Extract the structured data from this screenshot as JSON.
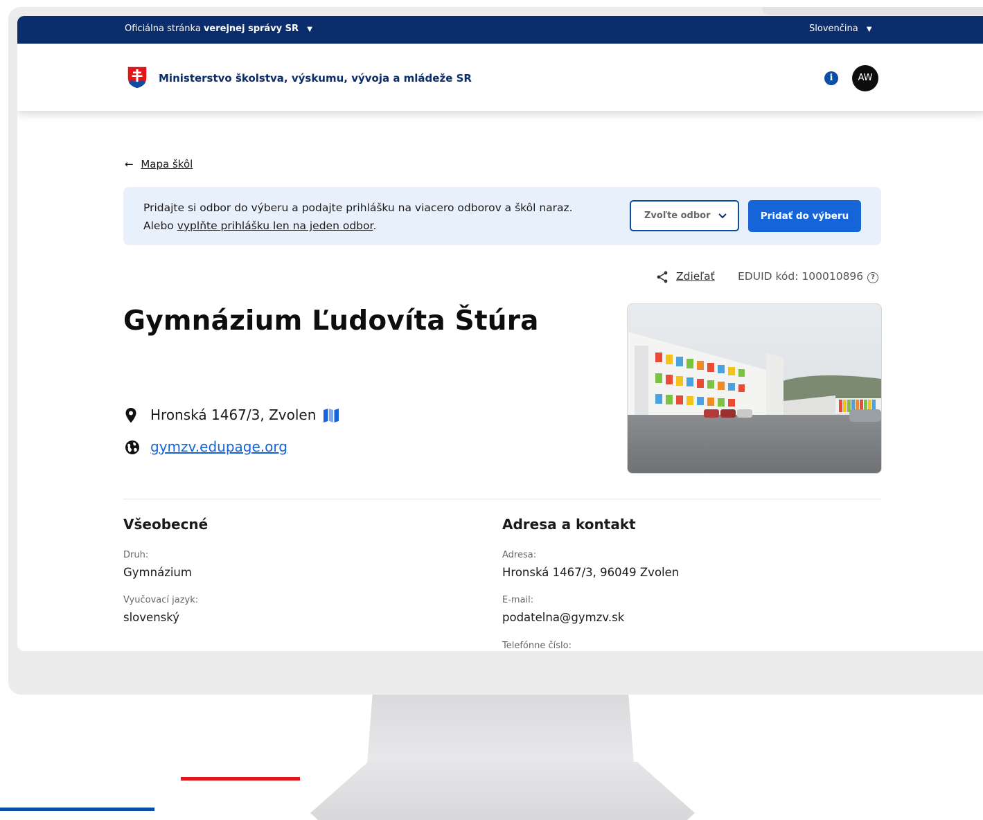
{
  "topbar": {
    "official_prefix": "Oficiálna stránka",
    "official_bold": "verejnej správy SR",
    "language": "Slovenčina"
  },
  "header": {
    "ministry_name": "Ministerstvo školstva, výskumu, vývoja a mládeže SR",
    "avatar_initials": "AW",
    "info_glyph": "i"
  },
  "nav": {
    "back_arrow": "←",
    "back_label": "Mapa škôl"
  },
  "banner": {
    "line1": "Pridajte si odbor do výberu a podajte prihlášku na viacero odborov a škôl naraz.",
    "line2_prefix": "Alebo ",
    "line2_link": "vyplňte prihlášku len na jeden odbor",
    "line2_suffix": ".",
    "select_label": "Zvoľte odbor",
    "add_button": "Pridať do výberu"
  },
  "meta": {
    "share_label": "Zdieľať",
    "eduid": "EDUID kód: 100010896"
  },
  "school": {
    "name": "Gymnázium Ľudovíta Štúra",
    "address": "Hronská 1467/3, Zvolen",
    "website": "gymzv.edupage.org"
  },
  "general": {
    "heading": "Všeobecné",
    "type_label": "Druh:",
    "type_value": "Gymnázium",
    "language_label": "Vyučovací jazyk:",
    "language_value": "slovenský"
  },
  "contact": {
    "heading": "Adresa a kontakt",
    "address_label": "Adresa:",
    "address_value": "Hronská 1467/3, 96049 Zvolen",
    "email_label": "E-mail:",
    "email_value": "podatelna@gymzv.sk",
    "phone_label": "Telefónne číslo:"
  },
  "colors": {
    "gov_navy": "#0b2d6b",
    "primary_blue": "#1565d8",
    "banner_bg": "#e8f0fb",
    "deco_red": "#e3151b",
    "deco_blue": "#0b4da2"
  },
  "icons": [
    "chevron-down-icon",
    "slovak-crest-icon",
    "info-icon",
    "arrow-left-icon",
    "share-icon",
    "help-circle-icon",
    "location-pin-icon",
    "map-icon",
    "globe-icon"
  ]
}
